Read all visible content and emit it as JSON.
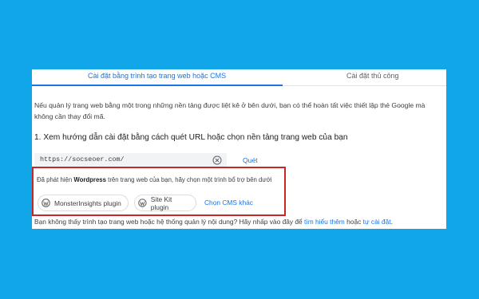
{
  "tabs": [
    {
      "label": "Cài đặt bằng trình tạo trang web hoặc CMS",
      "active": true
    },
    {
      "label": "Cài đặt thủ công",
      "active": false
    }
  ],
  "intro_text": "Nếu quản lý trang web bằng một trong những nền tảng được liệt kê ở bên dưới, bạn có thể hoàn tất việc thiết lập thẻ Google mà không cần thay đổi mã.",
  "step_title": "1. Xem hướng dẫn cài đặt bằng cách quét URL hoặc chọn nền tảng trang web của bạn",
  "url_input": {
    "value": "https://socseoer.com/",
    "clear_icon": "close-circle-icon"
  },
  "scan_button": "Quét",
  "detected": {
    "prefix": "Đã phát hiện ",
    "platform": "Wordpress",
    "suffix": " trên trang web của bạn, hãy chọn một trình bổ trợ bên dưới",
    "highlight_color": "#c62828"
  },
  "plugins": [
    {
      "label": "MonsterInsights plugin",
      "icon": "wordpress-icon"
    },
    {
      "label": "Site Kit plugin",
      "icon": "wordpress-icon"
    }
  ],
  "other_cms_link": "Chọn CMS khác",
  "footer": {
    "text": "Bạn không thấy trình tạo trang web hoặc hệ thống quản lý nội dung? Hãy nhấp vào đây để ",
    "link1": "tìm hiểu thêm",
    "middle": " hoặc ",
    "link2": "tự cài đặt",
    "end": "."
  },
  "colors": {
    "background": "#10a6e8",
    "accent": "#1a73e8"
  }
}
